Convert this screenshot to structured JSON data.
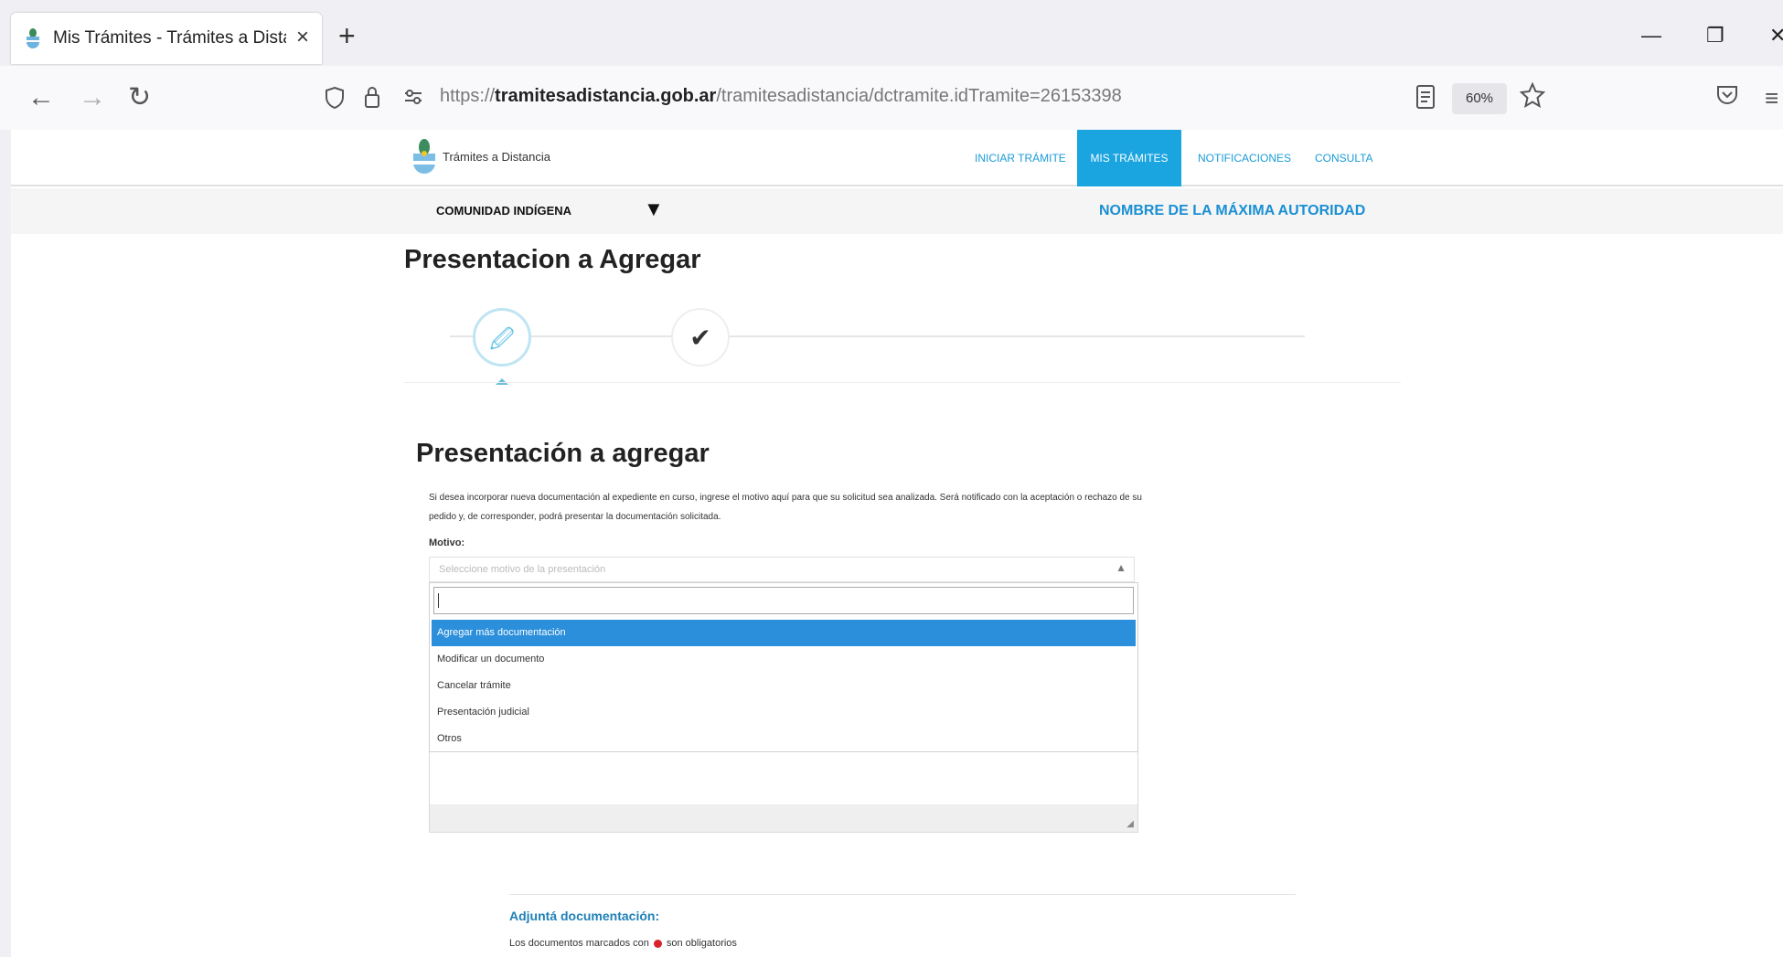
{
  "browser": {
    "tab_title": "Mis Trámites - Trámites a Distancia",
    "new_tab": "+",
    "tab_close": "×",
    "url_prefix": "https://",
    "url_domain": "tramitesadistancia.gob.ar",
    "url_path": "/tramitesadistancia/dctramite.idTramite=26153398",
    "zoom": "60%"
  },
  "header": {
    "logo_text": "Trámites a Distancia",
    "nav": [
      {
        "label": "Iniciar trámite"
      },
      {
        "label": "Mis trámites"
      },
      {
        "label": "Notificaciones"
      },
      {
        "label": "Consulta"
      }
    ]
  },
  "subbar": {
    "community": "COMUNIDAD INDÍGENA",
    "authority": "NOMBRE DE LA MÁXIMA AUTORIDAD"
  },
  "main": {
    "page_title": "Presentacion a Agregar",
    "section_title": "Presentación a agregar",
    "description": "Si desea incorporar nueva documentación al expediente en curso, ingrese el motivo aquí para que su solicitud sea analizada. Será notificado con la aceptación o rechazo de su pedido y, de corresponder, podrá presentar la documentación solicitada.",
    "motivo_label": "Motivo:",
    "select_placeholder": "Seleccione motivo de la presentación",
    "options": [
      {
        "label": "Agregar más documentación"
      },
      {
        "label": "Modificar un documento"
      },
      {
        "label": "Cancelar trámite"
      },
      {
        "label": "Presentación judicial"
      },
      {
        "label": "Otros"
      }
    ],
    "adjunta_title": "Adjuntá documentación:",
    "obligatorios_before": "Los documentos marcados con",
    "obligatorios_after": "son obligatorios"
  }
}
